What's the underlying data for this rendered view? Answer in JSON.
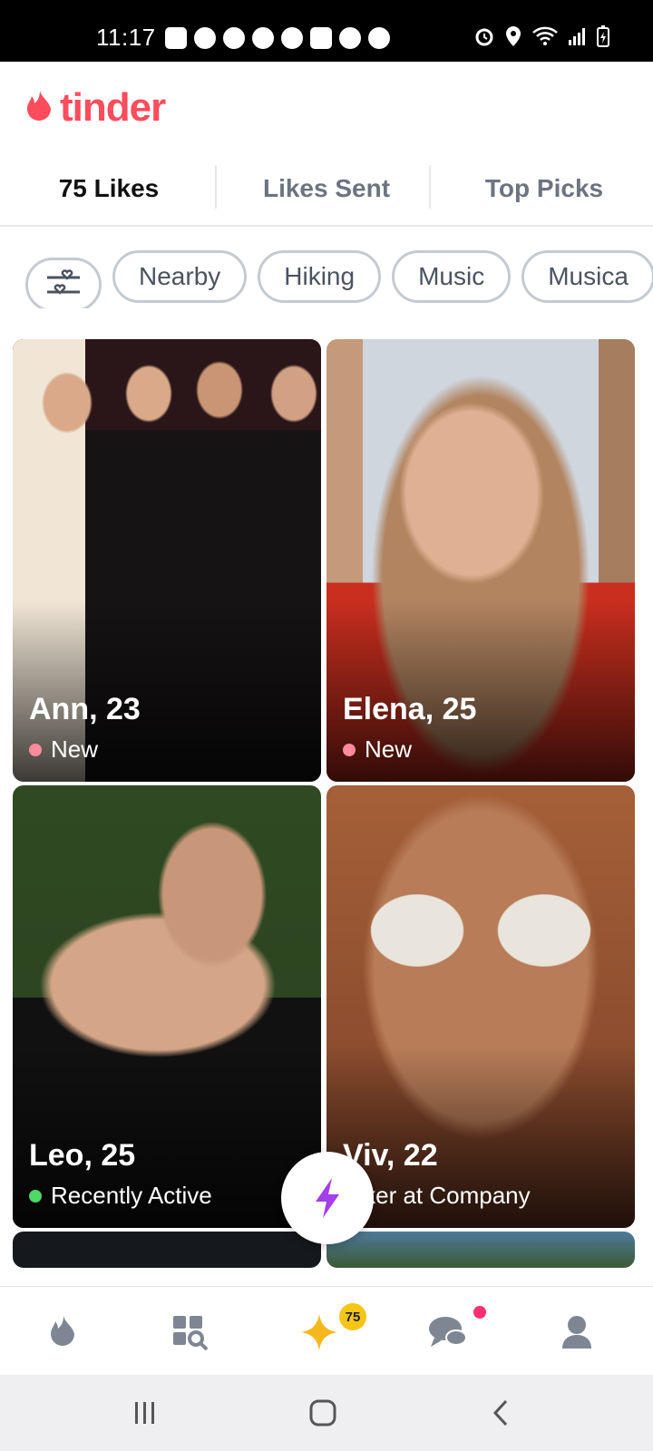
{
  "status_bar": {
    "time": "11:17"
  },
  "header": {
    "logo_text": "tinder"
  },
  "tabs": [
    {
      "label": "75 Likes",
      "active": true
    },
    {
      "label": "Likes Sent",
      "active": false
    },
    {
      "label": "Top Picks",
      "active": false
    }
  ],
  "filters": {
    "filter_icon": "filter-sliders-icon",
    "chips": [
      "Nearby",
      "Hiking",
      "Music",
      "Musica"
    ]
  },
  "cards": [
    {
      "name": "Ann, 23",
      "status": "New",
      "status_color": "#ff8a9b"
    },
    {
      "name": "Elena, 25",
      "status": "New",
      "status_color": "#ff8a9b"
    },
    {
      "name": "Leo, 25",
      "status": "Recently Active",
      "status_color": "#4cd964"
    },
    {
      "name": "Viv, 22",
      "status": "orker at Company",
      "status_color": ""
    }
  ],
  "bottom_nav": {
    "items": [
      "flame-icon",
      "explore-icon",
      "likes-star-icon",
      "chat-icon",
      "profile-icon"
    ],
    "likes_badge": "75"
  },
  "colors": {
    "brand": "#fd4c5c",
    "boost": "#a43ee8",
    "badge": "#f5c518"
  }
}
